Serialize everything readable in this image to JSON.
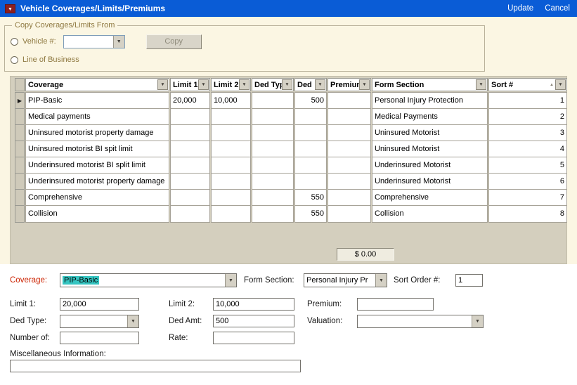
{
  "title_bar": {
    "title": "Vehicle Coverages/Limits/Premiums",
    "update_label": "Update",
    "cancel_label": "Cancel"
  },
  "copy_panel": {
    "legend": "Copy Coverages/Limits From",
    "vehicle_radio_label": "Vehicle #:",
    "vehicle_dropdown_value": "",
    "copy_button_label": "Copy",
    "line_of_business_radio_label": "Line of Business"
  },
  "grid": {
    "columns": [
      "Coverage",
      "Limit 1",
      "Limit 2",
      "Ded Type",
      "Ded",
      "Premium",
      "Form Section",
      "Sort #"
    ],
    "rows": [
      {
        "coverage": "PIP-Basic",
        "limit1": "20,000",
        "limit2": "10,000",
        "ded_type": "",
        "ded": "500",
        "premium": "",
        "form_section": "Personal Injury Protection",
        "sort": "1"
      },
      {
        "coverage": "Medical payments",
        "limit1": "",
        "limit2": "",
        "ded_type": "",
        "ded": "",
        "premium": "",
        "form_section": "Medical Payments",
        "sort": "2"
      },
      {
        "coverage": "Uninsured motorist property damage",
        "limit1": "",
        "limit2": "",
        "ded_type": "",
        "ded": "",
        "premium": "",
        "form_section": "Uninsured Motorist",
        "sort": "3"
      },
      {
        "coverage": "Uninsured motorist BI spit limit",
        "limit1": "",
        "limit2": "",
        "ded_type": "",
        "ded": "",
        "premium": "",
        "form_section": "Uninsured Motorist",
        "sort": "4"
      },
      {
        "coverage": "Underinsured motorist BI split limit",
        "limit1": "",
        "limit2": "",
        "ded_type": "",
        "ded": "",
        "premium": "",
        "form_section": "Underinsured Motorist",
        "sort": "5"
      },
      {
        "coverage": "Underinsured motorist property damage",
        "limit1": "",
        "limit2": "",
        "ded_type": "",
        "ded": "",
        "premium": "",
        "form_section": "Underinsured Motorist",
        "sort": "6"
      },
      {
        "coverage": "Comprehensive",
        "limit1": "",
        "limit2": "",
        "ded_type": "",
        "ded": "550",
        "premium": "",
        "form_section": "Comprehensive",
        "sort": "7"
      },
      {
        "coverage": "Collision",
        "limit1": "",
        "limit2": "",
        "ded_type": "",
        "ded": "550",
        "premium": "",
        "form_section": "Collision",
        "sort": "8"
      }
    ],
    "premium_total": "$ 0.00"
  },
  "form": {
    "coverage_label": "Coverage:",
    "coverage_value": "PIP-Basic",
    "form_section_label": "Form Section:",
    "form_section_value": "Personal Injury Pr",
    "sort_order_label": "Sort Order #:",
    "sort_order_value": "1",
    "limit1_label": "Limit 1:",
    "limit1_value": "20,000",
    "limit2_label": "Limit 2:",
    "limit2_value": "10,000",
    "premium_label": "Premium:",
    "premium_value": "",
    "ded_type_label": "Ded Type:",
    "ded_type_value": "",
    "ded_amt_label": "Ded Amt:",
    "ded_amt_value": "500",
    "valuation_label": "Valuation:",
    "valuation_value": "",
    "number_of_label": "Number of:",
    "number_of_value": "",
    "rate_label": "Rate:",
    "rate_value": "",
    "misc_label": "Miscellaneous Information:",
    "misc_value": ""
  },
  "colors": {
    "titlebar_blue": "#0a5cd6",
    "panel_cream": "#fbf6e3",
    "grid_tan": "#d4cfbe",
    "selection_teal": "#35c5c1",
    "label_olive": "#8e7840",
    "coverage_label_red": "#cc2200"
  }
}
